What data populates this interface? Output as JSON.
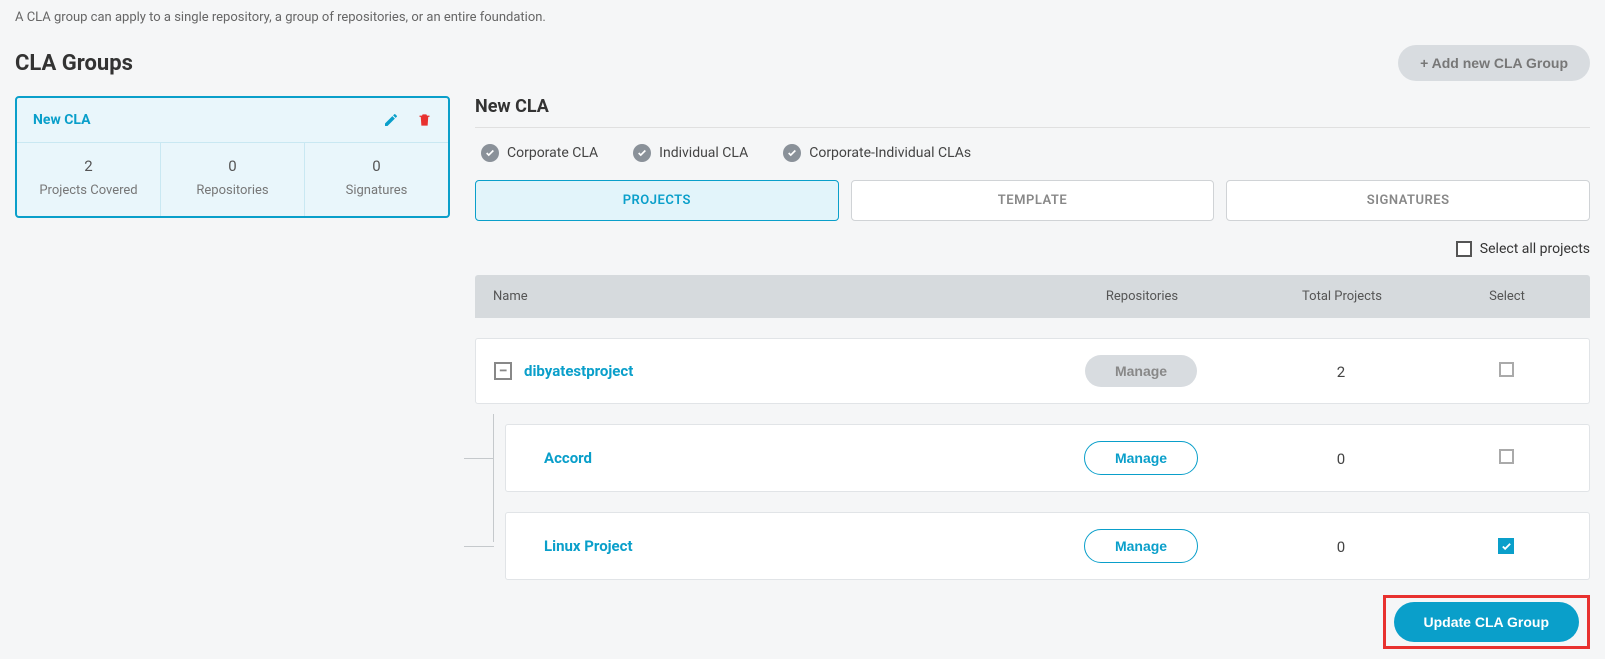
{
  "description": "A CLA group can apply to a single repository, a group of repositories, or an entire foundation.",
  "page_title": "CLA Groups",
  "add_button_label": "+ Add new CLA Group",
  "group_card": {
    "title": "New CLA",
    "stats": [
      {
        "value": "2",
        "label": "Projects Covered"
      },
      {
        "value": "0",
        "label": "Repositories"
      },
      {
        "value": "0",
        "label": "Signatures"
      }
    ]
  },
  "main": {
    "section_title": "New CLA",
    "cla_types": [
      "Corporate CLA",
      "Individual CLA",
      "Corporate-Individual CLAs"
    ],
    "tabs": [
      {
        "label": "PROJECTS",
        "active": true
      },
      {
        "label": "TEMPLATE",
        "active": false
      },
      {
        "label": "SIGNATURES",
        "active": false
      }
    ],
    "select_all_label": "Select all projects",
    "table": {
      "headers": {
        "name": "Name",
        "repos": "Repositories",
        "projects": "Total Projects",
        "select": "Select"
      },
      "parent": {
        "name": "dibyatestproject",
        "manage_label": "Manage",
        "projects": "2"
      },
      "children": [
        {
          "name": "Accord",
          "manage_label": "Manage",
          "projects": "0",
          "selected": false
        },
        {
          "name": "Linux Project",
          "manage_label": "Manage",
          "projects": "0",
          "selected": true
        }
      ]
    },
    "update_button_label": "Update CLA Group"
  }
}
